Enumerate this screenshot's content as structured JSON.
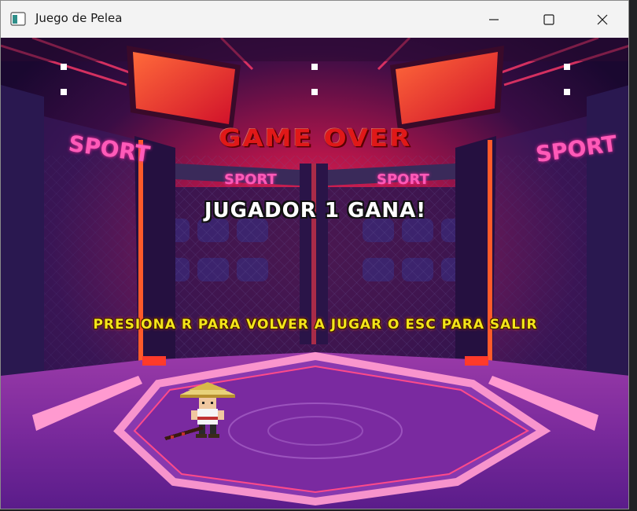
{
  "window": {
    "title": "Juego de Pelea",
    "controls": {
      "minimize": "minimize",
      "maximize": "maximize",
      "close": "close"
    }
  },
  "game": {
    "game_over_text": "GAME OVER",
    "winner_text": "JUGADOR 1 GANA!",
    "prompt_text": "PRESIONA R PARA VOLVER A JUGAR O ESC PARA SALIR",
    "signs": {
      "left": "SPORT",
      "right": "SPORT",
      "inner_left": "SPORT",
      "inner_right": "SPORT"
    }
  },
  "colors": {
    "game_over": "#e01818",
    "winner": "#ffffff",
    "prompt": "#f5e51a",
    "sign": "#ff5ab8"
  }
}
